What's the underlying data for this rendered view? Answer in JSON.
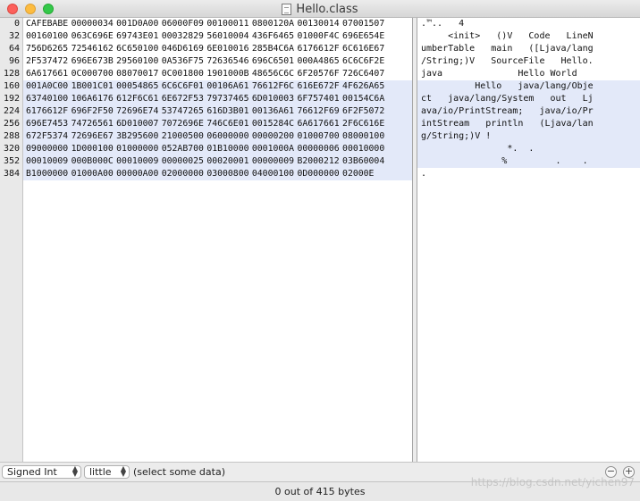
{
  "window": {
    "title": "Hello.class"
  },
  "gutter": [
    "0",
    "32",
    "64",
    "96",
    "128",
    "160",
    "192",
    "224",
    "256",
    "288",
    "320",
    "352",
    "384"
  ],
  "hex_rows": [
    [
      "CAFEBABE",
      "00000034",
      "001D0A00",
      "06000F09",
      "00100011",
      "0800120A",
      "00130014",
      "07001507"
    ],
    [
      "00160100",
      "063C696E",
      "69743E01",
      "00032829",
      "56010004",
      "436F6465",
      "01000F4C",
      "696E654E"
    ],
    [
      "756D6265",
      "72546162",
      "6C650100",
      "046D6169",
      "6E010016",
      "285B4C6A",
      "6176612F",
      "6C616E67"
    ],
    [
      "2F537472",
      "696E673B",
      "29560100",
      "0A536F75",
      "72636546",
      "696C6501",
      "000A4865",
      "6C6C6F2E"
    ],
    [
      "6A617661",
      "0C000700",
      "08070017",
      "0C001800",
      "1901000B",
      "48656C6C",
      "6F20576F",
      "726C6407"
    ],
    [
      "001A0C00",
      "1B001C01",
      "00054865",
      "6C6C6F01",
      "00106A61",
      "76612F6C",
      "616E672F",
      "4F626A65"
    ],
    [
      "63740100",
      "106A6176",
      "612F6C61",
      "6E672F53",
      "79737465",
      "6D010003",
      "6F757401",
      "00154C6A"
    ],
    [
      "6176612F",
      "696F2F50",
      "72696E74",
      "53747265",
      "616D3B01",
      "00136A61",
      "76612F69",
      "6F2F5072"
    ],
    [
      "696E7453",
      "74726561",
      "6D010007",
      "7072696E",
      "746C6E01",
      "0015284C",
      "6A617661",
      "2F6C616E"
    ],
    [
      "672F5374",
      "72696E67",
      "3B295600",
      "21000500",
      "06000000",
      "00000200",
      "01000700",
      "08000100"
    ],
    [
      "09000000",
      "1D000100",
      "01000000",
      "052AB700",
      "01B10000",
      "0001000A",
      "00000006",
      "00010000"
    ],
    [
      "00010009",
      "000B000C",
      "00010009",
      "00000025",
      "00020001",
      "00000009",
      "B2000212",
      "03B60004"
    ],
    [
      "B1000000",
      "01000A00",
      "00000A00",
      "02000000",
      "03000800",
      "04000100",
      "0D000000",
      "02000E"
    ]
  ],
  "ascii_rows": [
    ".™..   4",
    "     <init>   ()V   Code   LineN",
    "umberTable   main   ([Ljava/lang",
    "/String;)V   SourceFile   Hello.",
    "java              Hello World",
    "          Hello   java/lang/Obje",
    "ct   java/lang/System   out   Lj",
    "ava/io/PrintStream;   java/io/Pr",
    "intStream   println   (Ljava/lan",
    "g/String;)V !",
    "                *.  .",
    "               %         .    .",
    "."
  ],
  "bottom": {
    "int_type": "Signed Int",
    "endian": "little",
    "selection_hint": "(select some data)",
    "minus": "−",
    "plus": "+"
  },
  "status": {
    "text": "0 out of 415 bytes"
  },
  "watermark": "https://blog.csdn.net/yichen97",
  "colors": {
    "row_shade": "#e3e9f9"
  }
}
